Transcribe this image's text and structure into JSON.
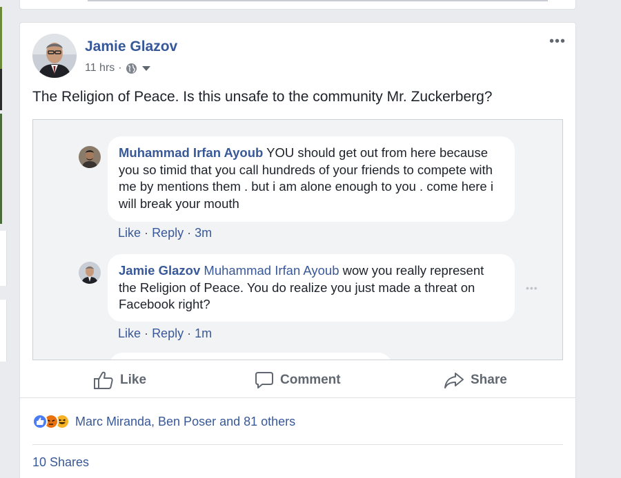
{
  "post": {
    "author": "Jamie Glazov",
    "time": "11 hrs",
    "separator": "·",
    "privacy_icon": "globe-icon",
    "text": "The Religion of Peace. Is this unsafe to the community Mr. Zuckerberg?"
  },
  "embed": {
    "comments": [
      {
        "name": "Muhammad Irfan Ayoub",
        "tag": "",
        "text": " YOU should get out from here because you so timid that you call hundreds of your friends to compete with me by mentions them . but i am alone enough to you . come here i will break your mouth",
        "like": "Like",
        "dot1": "·",
        "reply": "Reply",
        "dot2": "·",
        "time": "3m"
      },
      {
        "name": "Jamie Glazov",
        "tag": " Muhammad Irfan Ayoub",
        "text": " wow you really represent the Religion of Peace. You do realize you just made a threat on Facebook right?",
        "like": "Like",
        "dot1": "·",
        "reply": "Reply",
        "dot2": "·",
        "time": "1m"
      }
    ]
  },
  "actions": {
    "like": "Like",
    "comment": "Comment",
    "share": "Share"
  },
  "reactions": {
    "icons": [
      "like-reaction-icon",
      "angry-reaction-icon",
      "haha-reaction-icon"
    ],
    "text": "Marc Miranda, Ben Poser and 81 others"
  },
  "shares": "10 Shares",
  "colors": {
    "link_blue": "#385898",
    "background": "#e9ebee",
    "card": "#ffffff"
  }
}
